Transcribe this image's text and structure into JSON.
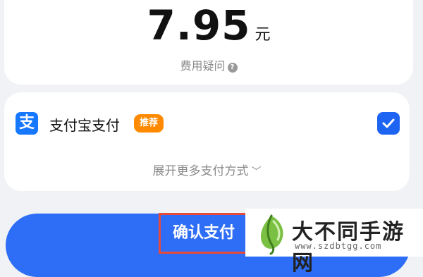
{
  "price": {
    "amount": "7.95",
    "unit": "元",
    "fee_question": "费用疑问",
    "help_icon": "question-circle-icon"
  },
  "payment": {
    "method_label": "支付宝支付",
    "method_icon": "alipay-icon",
    "badge": "推荐",
    "selected": true,
    "more_label": "展开更多支付方式",
    "chevron_icon": "chevron-down-icon"
  },
  "confirm": {
    "label": "确认支付"
  },
  "watermark": {
    "text": "大不同手游网",
    "subtext": "www.szdbtgg.com"
  },
  "colors": {
    "accent": "#2e6df5",
    "badge": "#ff8a00",
    "highlight": "#e64a3b",
    "alipay": "#1677ff"
  }
}
